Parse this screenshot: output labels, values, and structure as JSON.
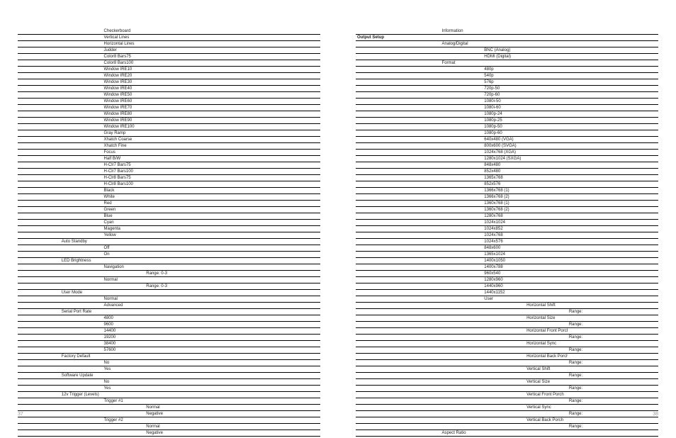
{
  "pageNumbers": {
    "left": "37",
    "right": "38"
  },
  "leftRows": [
    {
      "col": 3,
      "text": "Checkerboard"
    },
    {
      "col": 3,
      "text": "Vertical Lines"
    },
    {
      "col": 3,
      "text": "Horizontal Lines"
    },
    {
      "col": 3,
      "text": "Judder"
    },
    {
      "col": 3,
      "text": "Color8 Bars75"
    },
    {
      "col": 3,
      "text": "Color8 Bars100"
    },
    {
      "col": 3,
      "text": "Window IRE10"
    },
    {
      "col": 3,
      "text": "Window IRE20"
    },
    {
      "col": 3,
      "text": "Window IRE30"
    },
    {
      "col": 3,
      "text": "Window IRE40"
    },
    {
      "col": 3,
      "text": "Window IRE50"
    },
    {
      "col": 3,
      "text": "Window IRE60"
    },
    {
      "col": 3,
      "text": "Window IRE70"
    },
    {
      "col": 3,
      "text": "Window IRE80"
    },
    {
      "col": 3,
      "text": "Window IRE90"
    },
    {
      "col": 3,
      "text": "Window IRE100"
    },
    {
      "col": 3,
      "text": "Gray Ramp"
    },
    {
      "col": 3,
      "text": "Xhatch Coarse"
    },
    {
      "col": 3,
      "text": "Xhatch Fine"
    },
    {
      "col": 3,
      "text": "Focus"
    },
    {
      "col": 3,
      "text": "Half B/W"
    },
    {
      "col": 3,
      "text": "H-Clr7 Bars75"
    },
    {
      "col": 3,
      "text": "H-Clr7 Bars100"
    },
    {
      "col": 3,
      "text": "H-Clr8 Bars75"
    },
    {
      "col": 3,
      "text": "H-Clr8 Bars100"
    },
    {
      "col": 3,
      "text": "Black"
    },
    {
      "col": 3,
      "text": "White"
    },
    {
      "col": 3,
      "text": "Red"
    },
    {
      "col": 3,
      "text": "Green"
    },
    {
      "col": 3,
      "text": "Blue"
    },
    {
      "col": 3,
      "text": "Cyan"
    },
    {
      "col": 3,
      "text": "Magenta"
    },
    {
      "col": 3,
      "text": "Yellow"
    },
    {
      "col": 2,
      "text": "Auto Standby"
    },
    {
      "col": 3,
      "text": "Off"
    },
    {
      "col": 3,
      "text": "On"
    },
    {
      "col": 2,
      "text": "LED Brightness"
    },
    {
      "col": 3,
      "text": "Navigation"
    },
    {
      "col": 4,
      "text": "Range: 0-3"
    },
    {
      "col": 3,
      "text": "Normal"
    },
    {
      "col": 4,
      "text": "Range: 0-3"
    },
    {
      "col": 2,
      "text": "User Mode"
    },
    {
      "col": 3,
      "text": "Normal"
    },
    {
      "col": 3,
      "text": "Advanced"
    },
    {
      "col": 2,
      "text": "Serial Port Rate"
    },
    {
      "col": 3,
      "text": "4800"
    },
    {
      "col": 3,
      "text": "9600"
    },
    {
      "col": 3,
      "text": "14400"
    },
    {
      "col": 3,
      "text": "19200"
    },
    {
      "col": 3,
      "text": "38400"
    },
    {
      "col": 3,
      "text": "57600"
    },
    {
      "col": 2,
      "text": "Factory Default"
    },
    {
      "col": 3,
      "text": "No"
    },
    {
      "col": 3,
      "text": "Yes"
    },
    {
      "col": 2,
      "text": "Software Update"
    },
    {
      "col": 3,
      "text": "No"
    },
    {
      "col": 3,
      "text": "Yes"
    },
    {
      "col": 2,
      "text": "12v Trigger (Levels)"
    },
    {
      "col": 3,
      "text": "Trigger #1"
    },
    {
      "col": 4,
      "text": "Normal"
    },
    {
      "col": 4,
      "text": "Negative"
    },
    {
      "col": 3,
      "text": "Trigger #2"
    },
    {
      "col": 4,
      "text": "Normal"
    },
    {
      "col": 4,
      "text": "Negative"
    }
  ],
  "rightRows": [
    {
      "col": 3,
      "text": "Information"
    },
    {
      "col": 1,
      "text": "Output Setup",
      "bold": true
    },
    {
      "col": 3,
      "text": "Analog/Digital"
    },
    {
      "col": 4,
      "text": "BNC (Analog)"
    },
    {
      "col": 4,
      "text": "HDMI (Digital)"
    },
    {
      "col": 3,
      "text": "Format"
    },
    {
      "col": 4,
      "text": "480p"
    },
    {
      "col": 4,
      "text": "540p"
    },
    {
      "col": 4,
      "text": "576p"
    },
    {
      "col": 4,
      "text": "720p-50"
    },
    {
      "col": 4,
      "text": "720p-60"
    },
    {
      "col": 4,
      "text": "1080i-50"
    },
    {
      "col": 4,
      "text": "1080i-60"
    },
    {
      "col": 4,
      "text": "1080p-24"
    },
    {
      "col": 4,
      "text": "1080p-25"
    },
    {
      "col": 4,
      "text": "1080p-50"
    },
    {
      "col": 4,
      "text": "1080p-60"
    },
    {
      "col": 4,
      "text": "640x480 (VGA)"
    },
    {
      "col": 4,
      "text": "800x600 (SVGA)"
    },
    {
      "col": 4,
      "text": "1024x768 (XGA)"
    },
    {
      "col": 4,
      "text": "1280x1024 (SXGA)"
    },
    {
      "col": 4,
      "text": "848x480"
    },
    {
      "col": 4,
      "text": "852x480"
    },
    {
      "col": 4,
      "text": "1365x768"
    },
    {
      "col": 4,
      "text": "852x576"
    },
    {
      "col": 4,
      "text": "1366x768 (1)"
    },
    {
      "col": 4,
      "text": "1366x768 (2)"
    },
    {
      "col": 4,
      "text": "1360x768 (1)"
    },
    {
      "col": 4,
      "text": "1360x768 (2)"
    },
    {
      "col": 4,
      "text": "1280x768"
    },
    {
      "col": 4,
      "text": "1024x1024"
    },
    {
      "col": 4,
      "text": "1024x852"
    },
    {
      "col": 4,
      "text": "1024x768"
    },
    {
      "col": 4,
      "text": "1024x576"
    },
    {
      "col": 4,
      "text": "848x600"
    },
    {
      "col": 4,
      "text": "1365x1024"
    },
    {
      "col": 4,
      "text": "1400x1050"
    },
    {
      "col": 4,
      "text": "1400x788"
    },
    {
      "col": 4,
      "text": "960x540"
    },
    {
      "col": 4,
      "text": "1280x960"
    },
    {
      "col": 4,
      "text": "1440x960"
    },
    {
      "col": 4,
      "text": "1440x1152"
    },
    {
      "col": 4,
      "text": "User"
    },
    {
      "col": 5,
      "text": "Horizontal Shift"
    },
    {
      "col": 6,
      "text": "Range:"
    },
    {
      "col": 5,
      "text": "Horizontal Size"
    },
    {
      "col": 6,
      "text": "Range:"
    },
    {
      "col": 5,
      "text": "Horizontal Front Porch"
    },
    {
      "col": 6,
      "text": "Range:"
    },
    {
      "col": 5,
      "text": "Horizontal Sync"
    },
    {
      "col": 6,
      "text": "Range:"
    },
    {
      "col": 5,
      "text": "Horizontal Back Porch"
    },
    {
      "col": 6,
      "text": "Range:"
    },
    {
      "col": 5,
      "text": "Vertical Shift"
    },
    {
      "col": 6,
      "text": "Range:"
    },
    {
      "col": 5,
      "text": "Vertical Size"
    },
    {
      "col": 6,
      "text": "Range:"
    },
    {
      "col": 5,
      "text": "Vertical Front Porch"
    },
    {
      "col": 6,
      "text": "Range:"
    },
    {
      "col": 5,
      "text": "Vertical Sync"
    },
    {
      "col": 6,
      "text": "Range:"
    },
    {
      "col": 5,
      "text": "Vertical Back Porch"
    },
    {
      "col": 6,
      "text": "Range:"
    },
    {
      "col": 3,
      "text": "Aspect Ratio"
    }
  ]
}
